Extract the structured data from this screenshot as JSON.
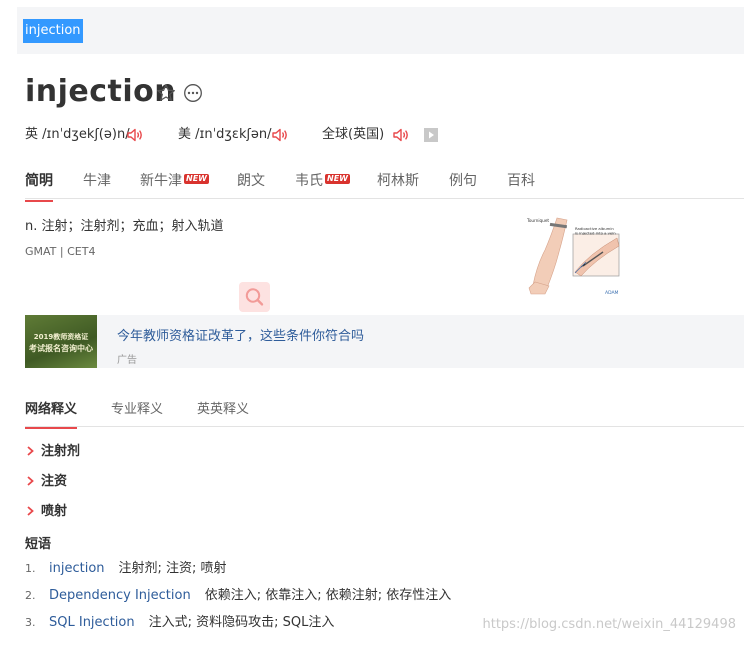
{
  "search": {
    "query": "injection"
  },
  "word": {
    "headword": "injection",
    "actions": {
      "favorite_icon": "star-outline-icon",
      "more_icon": "ellipsis-circle-icon"
    }
  },
  "pronunciations": [
    {
      "label": "英 /ɪnˈdʒekʃ(ə)n/"
    },
    {
      "label": "美 /ɪnˈdʒɛkʃən/"
    },
    {
      "label": "全球(英国)"
    }
  ],
  "dict_tabs": [
    {
      "label": "简明",
      "active": true,
      "new": false
    },
    {
      "label": "牛津",
      "active": false,
      "new": false
    },
    {
      "label": "新牛津",
      "active": false,
      "new": true
    },
    {
      "label": "朗文",
      "active": false,
      "new": false
    },
    {
      "label": "韦氏",
      "active": false,
      "new": true
    },
    {
      "label": "柯林斯",
      "active": false,
      "new": false
    },
    {
      "label": "例句",
      "active": false,
      "new": false
    },
    {
      "label": "百科",
      "active": false,
      "new": false
    }
  ],
  "badge": {
    "new_label": "NEW"
  },
  "definition": {
    "text": "n. 注射；注射剂；充血；射入轨道",
    "exams": "GMAT | CET4"
  },
  "illustration": {
    "caption_1": "Tourniquet",
    "caption_2": "Radioactive albumin",
    "caption_3": "is injected into a vein",
    "credit": "ADAM"
  },
  "ad": {
    "thumb_line_1": "2019教师资格证",
    "thumb_line_2": "考试报名咨询中心",
    "title": "今年教师资格证改革了，这些条件你符合吗",
    "label": "广告"
  },
  "section_tabs": [
    {
      "label": "网络释义",
      "active": true
    },
    {
      "label": "专业释义",
      "active": false
    },
    {
      "label": "英英释义",
      "active": false
    }
  ],
  "web_meanings": [
    "注射剂",
    "注资",
    "喷射"
  ],
  "phrases": {
    "heading": "短语",
    "items": [
      {
        "num": "1.",
        "en": "injection",
        "zh": "注射剂;  注资;  喷射"
      },
      {
        "num": "2.",
        "en": "Dependency Injection",
        "zh": "依赖注入;  依靠注入;  依赖注射;  依存性注入"
      },
      {
        "num": "3.",
        "en": "SQL Injection",
        "zh": "注入式;  资料隐码攻击;  SQL注入"
      }
    ]
  },
  "watermark": "https://blog.csdn.net/weixin_44129498",
  "colors": {
    "accent_red": "#e8484b",
    "link_blue": "#2e5c9a",
    "selection_blue": "#3399ff"
  }
}
